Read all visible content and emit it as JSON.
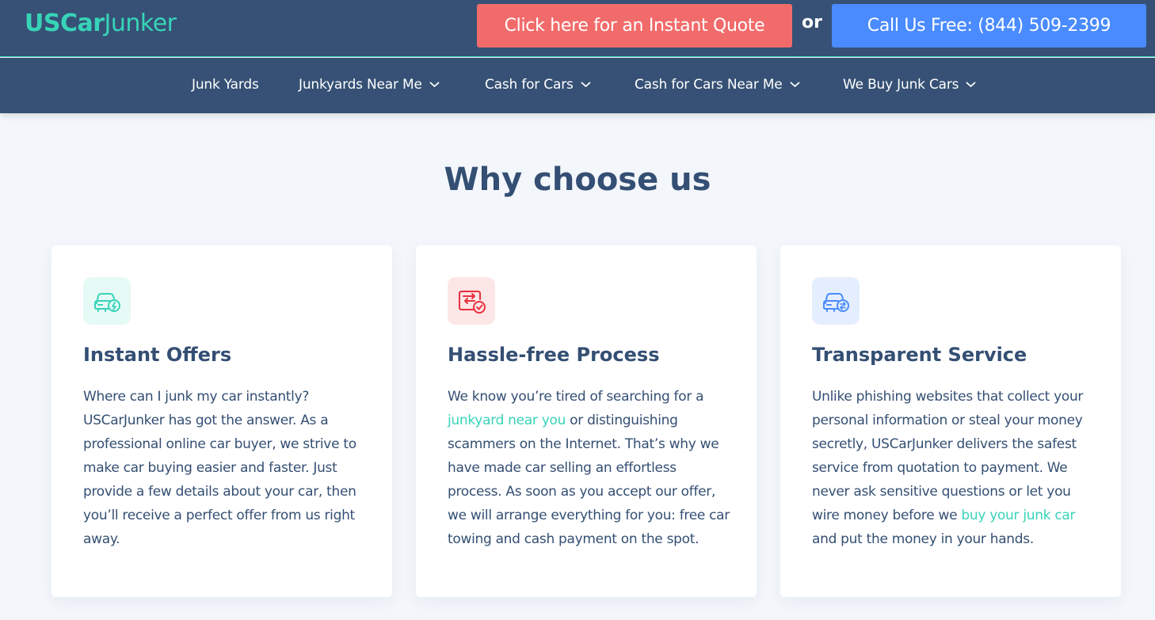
{
  "header": {
    "logo_bold": "USCar",
    "logo_light": "Junker",
    "quote_button": "Click here for an Instant Quote",
    "or_text": "or",
    "call_button": "Call Us Free: (844) 509-2399",
    "accent_color": "#37d4b8",
    "header_bg": "#365175"
  },
  "nav": {
    "items": [
      {
        "label": "Junk Yards",
        "has_dropdown": false
      },
      {
        "label": "Junkyards Near Me",
        "has_dropdown": true
      },
      {
        "label": "Cash for Cars",
        "has_dropdown": true
      },
      {
        "label": "Cash for Cars Near Me",
        "has_dropdown": true
      },
      {
        "label": "We Buy Junk Cars",
        "has_dropdown": true
      }
    ]
  },
  "section": {
    "title": "Why choose us"
  },
  "cards": [
    {
      "icon": "car-lightning-icon",
      "icon_color": "#37d4b8",
      "icon_bg": "#e6faf6",
      "title": "Instant Offers",
      "body_1": "Where can I junk my car instantly? USCarJunker has got the answer. As a professional online car buyer, we strive to make car buying easier and faster. Just provide a few details about your car, then you’ll receive a perfect offer from us right away."
    },
    {
      "icon": "card-exchange-check-icon",
      "icon_color": "#e8303f",
      "icon_bg": "#fde6e6",
      "title": "Hassle-free Process",
      "body_1": "We know you’re tired of searching for a",
      "link": "junkyard near you",
      "body_2": "or distinguishing scammers on the Internet. That’s why we have made car selling an effortless process. As soon as you accept our offer, we will arrange everything for you: free car towing and cash payment on the spot."
    },
    {
      "icon": "car-exchange-icon",
      "icon_color": "#4a8bff",
      "icon_bg": "#e5eefe",
      "title": "Transparent Service",
      "body_1": "Unlike phishing websites that collect your personal information or steal your money secretly, USCarJunker delivers the safest service from quotation to payment. We never ask sensitive questions or let you wire money before we",
      "link": "buy your junk car",
      "body_2": "and put the money in your hands."
    }
  ]
}
